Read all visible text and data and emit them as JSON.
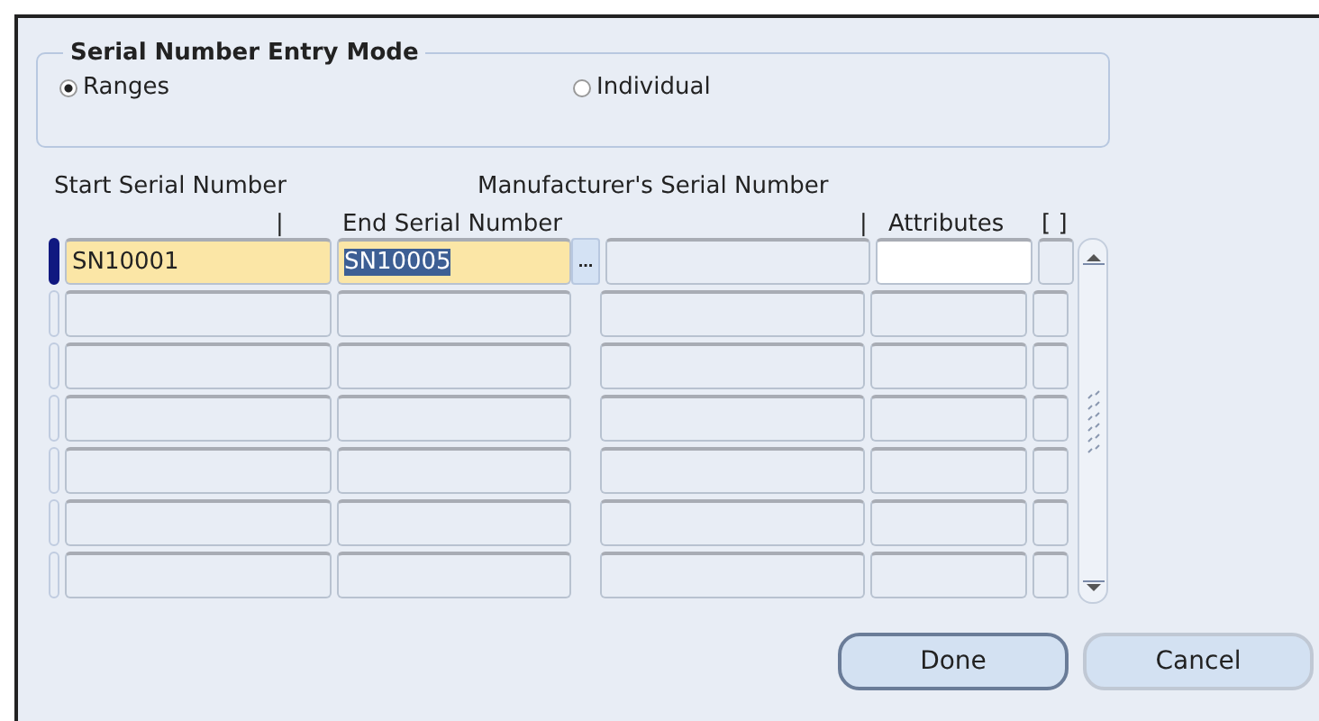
{
  "entry_mode": {
    "title": "Serial Number Entry Mode",
    "options": [
      {
        "label": "Ranges",
        "selected": true
      },
      {
        "label": "Individual",
        "selected": false
      }
    ]
  },
  "table": {
    "headers": {
      "start": "Start Serial Number",
      "end_marker": "|",
      "end": "End Serial Number",
      "manufacturer": "Manufacturer's Serial Number",
      "attributes_marker": "|",
      "attributes": "Attributes",
      "flex": "[ ]"
    },
    "lov_button": "...",
    "rows": [
      {
        "current": true,
        "start": "SN10001",
        "end": "SN10005",
        "end_selected": true
      },
      {
        "current": false
      },
      {
        "current": false
      },
      {
        "current": false
      },
      {
        "current": false
      },
      {
        "current": false
      },
      {
        "current": false
      }
    ]
  },
  "buttons": [
    {
      "label": "Done",
      "default": true
    },
    {
      "label": "Cancel",
      "default": false
    }
  ]
}
